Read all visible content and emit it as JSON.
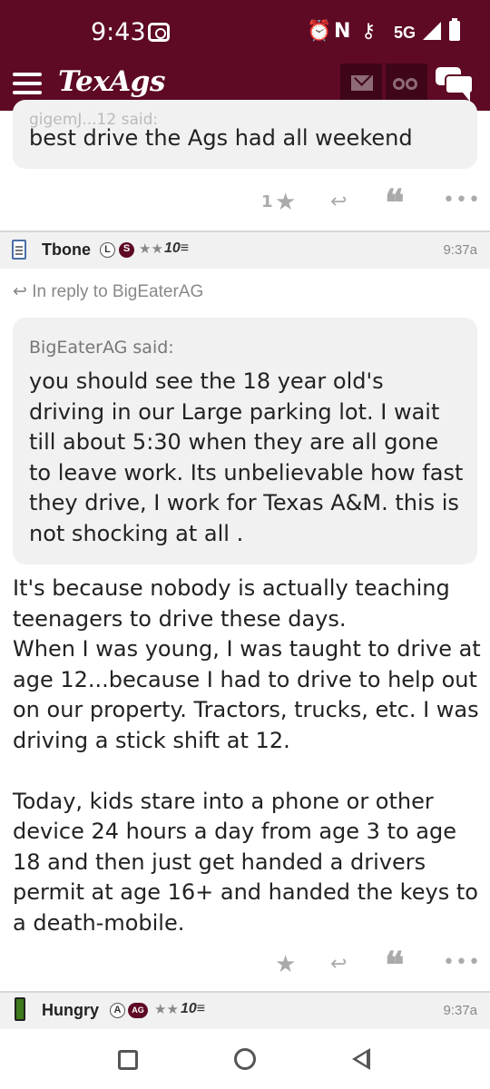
{
  "status_bar": {
    "time": "9:43",
    "network": "5G",
    "icons": [
      "camera-icon",
      "alarm-icon",
      "nfc-icon",
      "key-icon",
      "signal-icon",
      "battery-icon"
    ]
  },
  "header": {
    "logo": "TexAgs",
    "buttons": [
      "menu-icon",
      "mail-icon",
      "binoculars-icon",
      "chat-icon"
    ],
    "color": "#5e0a24"
  },
  "posts": [
    {
      "quote_partial_attribution": "gigemJ...12 said:",
      "quote_text": "best drive the Ags had all weekend",
      "actions": {
        "like_count": "1",
        "icons": [
          "star-icon",
          "reply-icon",
          "quote-icon",
          "more-icon"
        ]
      }
    },
    {
      "username": "Tbone",
      "badges": [
        "L",
        "S"
      ],
      "stars": "★★",
      "rank": "10≡",
      "time": "9:37a",
      "reply_to": "In reply to BigEaterAG",
      "quote_attribution": "BigEaterAG said:",
      "quote_text": "you should see the 18 year old's driving in our Large parking lot. I wait till about 5:30 when they are all gone to leave work. Its unbelievable how fast they drive, I work for Texas A&M. this is not shocking at all .",
      "body_paragraph_1": "It's because nobody is actually teaching teenagers to drive these days.",
      "body_paragraph_2": "When I was young, I was taught to drive at age 12...because I had to drive to help out on our property. Tractors, trucks, etc. I was driving a stick shift at 12.",
      "body_paragraph_3": "Today, kids stare into a phone or other device 24 hours a day from age 3 to age 18 and then just get handed a drivers permit at age 16+ and handed the keys to a death-mobile.",
      "actions": {
        "icons": [
          "star-icon",
          "reply-icon",
          "quote-icon",
          "more-icon"
        ]
      }
    },
    {
      "username": "Hungry",
      "badges": [
        "A",
        "AG"
      ],
      "stars": "★★",
      "rank": "10≡",
      "time": "9:37a"
    }
  ],
  "glyphs": {
    "star": "★",
    "reply": "⤺",
    "quote": "❝",
    "more": "•••",
    "alarm": "⏰",
    "nfc": "N",
    "key": "⚷",
    "reply_arrow": "↩"
  }
}
